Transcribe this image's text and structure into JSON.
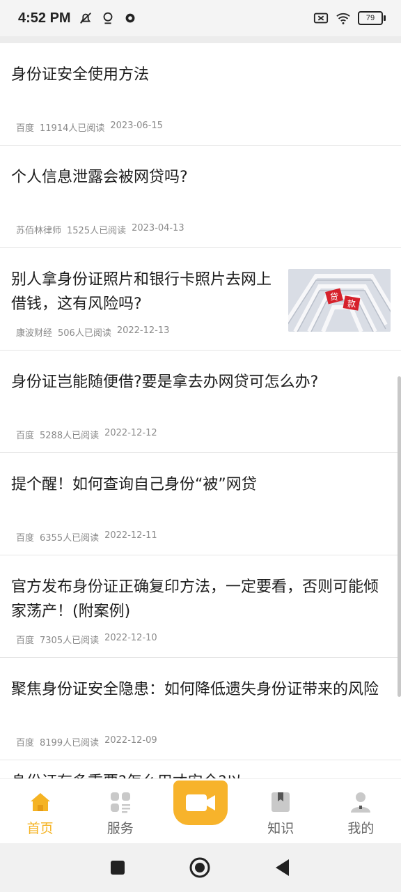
{
  "status": {
    "time": "4:52 PM",
    "battery": "79"
  },
  "articles": [
    {
      "title": "身份证安全使用方法",
      "source": "百度",
      "reads": "11914人已阅读",
      "date": "2023-06-15"
    },
    {
      "title": "个人信息泄露会被网贷吗?",
      "source": "苏佰林律师",
      "reads": "1525人已阅读",
      "date": "2023-04-13"
    },
    {
      "title": "别人拿身份证照片和银行卡照片去网上借钱，这有风险吗?",
      "source": "康波财经",
      "reads": "506人已阅读",
      "date": "2022-12-13",
      "thumb_text": "贷款"
    },
    {
      "title": "身份证岂能随便借?要是拿去办网贷可怎么办?",
      "source": "百度",
      "reads": "5288人已阅读",
      "date": "2022-12-12"
    },
    {
      "title": "提个醒！如何查询自己身份“被”网贷",
      "source": "百度",
      "reads": "6355人已阅读",
      "date": "2022-12-11"
    },
    {
      "title": "官方发布身份证正确复印方法，一定要看，否则可能倾家荡产！(附案例)",
      "source": "百度",
      "reads": "7305人已阅读",
      "date": "2022-12-10"
    },
    {
      "title": "聚焦身份证安全隐患：如何降低遗失身份证带来的风险",
      "source": "百度",
      "reads": "8199人已阅读",
      "date": "2022-12-09"
    },
    {
      "title": "身份证有多重要?怎么用才安全?以",
      "source": "",
      "reads": "",
      "date": ""
    }
  ],
  "nav": {
    "home": "首页",
    "service": "服务",
    "knowledge": "知识",
    "mine": "我的"
  },
  "colors": {
    "accent": "#f5b323",
    "text": "#1d1d1d",
    "meta": "#8a8a8a"
  }
}
